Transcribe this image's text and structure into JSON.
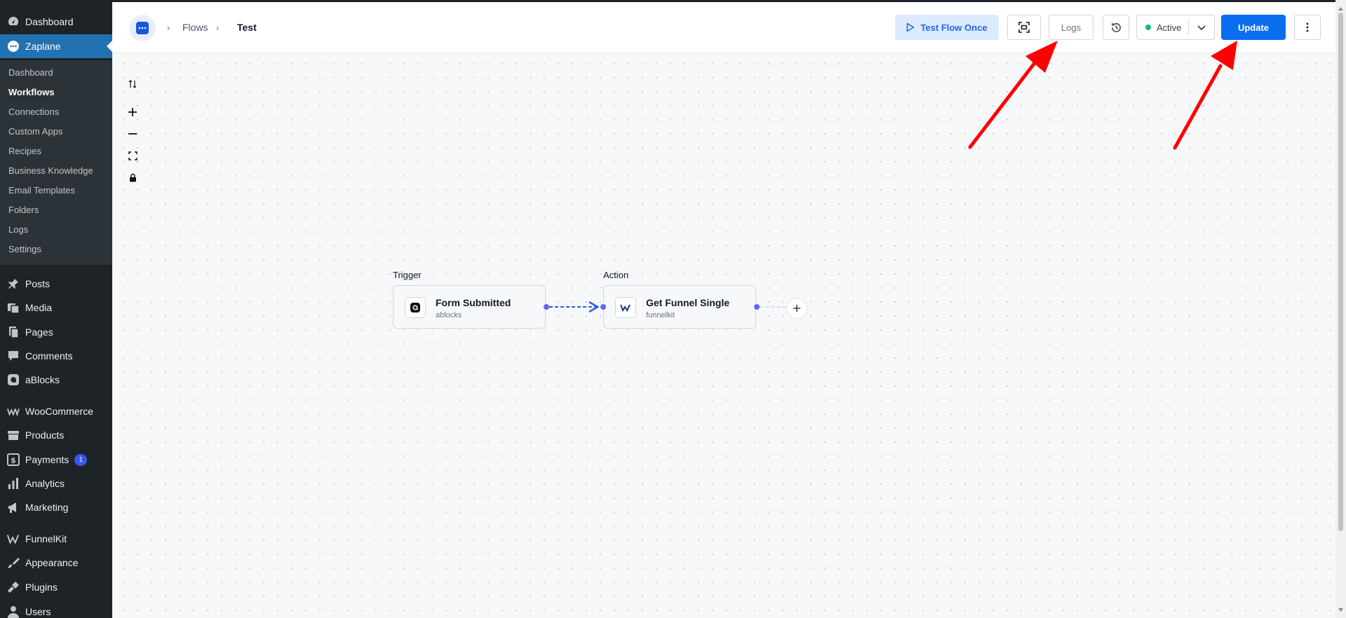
{
  "sidebar": {
    "top": [
      {
        "label": "Dashboard",
        "icon": "dashboard-icon"
      },
      {
        "label": "Zaplane",
        "icon": "zaplane-icon"
      }
    ],
    "submenu": [
      "Dashboard",
      "Workflows",
      "Connections",
      "Custom Apps",
      "Recipes",
      "Business Knowledge",
      "Email Templates",
      "Folders",
      "Logs",
      "Settings"
    ],
    "menu": [
      {
        "label": "Posts",
        "icon": "pin-icon"
      },
      {
        "label": "Media",
        "icon": "media-icon"
      },
      {
        "label": "Pages",
        "icon": "pages-icon"
      },
      {
        "label": "Comments",
        "icon": "comments-icon"
      },
      {
        "label": "aBlocks",
        "icon": "ablocks-icon"
      },
      {
        "label": "WooCommerce",
        "icon": "woocommerce-icon"
      },
      {
        "label": "Products",
        "icon": "products-icon"
      },
      {
        "label": "Payments",
        "icon": "payments-icon",
        "badge": "1"
      },
      {
        "label": "Analytics",
        "icon": "analytics-icon"
      },
      {
        "label": "Marketing",
        "icon": "megaphone-icon"
      },
      {
        "label": "FunnelKit",
        "icon": "funnelkit-icon"
      },
      {
        "label": "Appearance",
        "icon": "brush-icon"
      },
      {
        "label": "Plugins",
        "icon": "plug-icon"
      },
      {
        "label": "Users",
        "icon": "user-icon"
      }
    ]
  },
  "header": {
    "breadcrumb": [
      "Flows",
      "Test"
    ],
    "test_flow_label": "Test Flow Once",
    "logs_label": "Logs",
    "status_label": "Active",
    "update_label": "Update"
  },
  "flow": {
    "trigger": {
      "section": "Trigger",
      "title": "Form Submitted",
      "app": "ablocks"
    },
    "action": {
      "section": "Action",
      "title": "Get Funnel Single",
      "app": "funnelkit"
    }
  },
  "colors": {
    "accent": "#0b6ef0",
    "sidebar": "#1d2327",
    "current": "#2271b1",
    "annotation": "#ff0000"
  }
}
